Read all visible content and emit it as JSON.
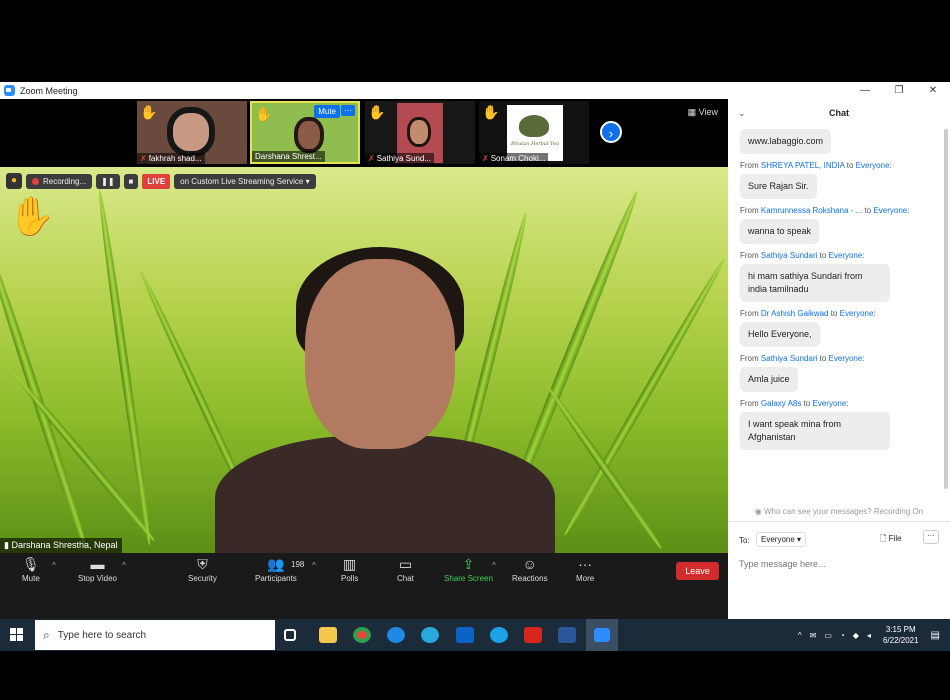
{
  "window": {
    "title": "Zoom Meeting",
    "controls": [
      "—",
      "❐",
      "✕"
    ]
  },
  "thumbnails": [
    {
      "name": "fakhrah shad...",
      "muted": true,
      "hand": "✋"
    },
    {
      "name": "Darshana Shrest...",
      "muted": false,
      "hand": "✋",
      "mute_label": "Mute",
      "more_label": "···"
    },
    {
      "name": "Sathiya Sund...",
      "muted": true,
      "hand": "✋"
    },
    {
      "name": "Sonam Choki...",
      "muted": true,
      "hand": "✋",
      "logo_text": "Bhutan Herbal Tea"
    }
  ],
  "view_label": "View",
  "recording": {
    "label": "Recording...",
    "pause": "❚❚",
    "stop": "■"
  },
  "live": {
    "badge": "LIVE",
    "service": "on Custom Live Streaming Service"
  },
  "speaker": {
    "name": "Darshana Shrestha, Nepal",
    "hand": "✋"
  },
  "toolbar": {
    "mute": "Mute",
    "stop_video": "Stop Video",
    "security": "Security",
    "participants": "Participants",
    "participant_count": "198",
    "polls": "Polls",
    "chat": "Chat",
    "share_screen": "Share Screen",
    "reactions": "Reactions",
    "more": "More",
    "leave": "Leave"
  },
  "chat": {
    "title": "Chat",
    "messages": [
      {
        "from": "",
        "to": "",
        "text": "www.labaggio.com"
      },
      {
        "from": "SHREYA PATEL, INDIA",
        "to": "Everyone",
        "text": "Sure Rajan Sir."
      },
      {
        "from": "Kamrunnessa Rokshana - ...",
        "to": "Everyone",
        "text": "wanna to speak"
      },
      {
        "from": "Sathiya Sundari",
        "to": "Everyone",
        "text": "hi mam sathiya Sundari from india tamilnadu"
      },
      {
        "from": "Dr  Ashish Gaikwad",
        "to": "Everyone",
        "text": "Hello Everyone,"
      },
      {
        "from": "Sathiya Sundari",
        "to": "Everyone",
        "text": "Amla juice"
      },
      {
        "from": "Galaxy A8s",
        "to": "Everyone",
        "text": "I  want speak mina from Afghanistan"
      }
    ],
    "from_word": "From",
    "to_word": "to",
    "privacy_note": "Who can see your messages? Recording On",
    "to_label": "To:",
    "to_value": "Everyone",
    "file_label": "File",
    "more_label": "···",
    "input_placeholder": "Type message here..."
  },
  "taskbar": {
    "search_placeholder": "Type here to search",
    "time": "3:15 PM",
    "date": "6/22/2021",
    "icons": [
      "task-view",
      "file-explorer",
      "chrome",
      "edge",
      "internet-explorer",
      "outlook",
      "skype",
      "acrobat",
      "word",
      "zoom"
    ]
  },
  "colors": {
    "zoom_blue": "#0e71eb",
    "leave_red": "#d12b2b",
    "share_green": "#3fcf56",
    "taskbar": "#1c2b3a"
  }
}
